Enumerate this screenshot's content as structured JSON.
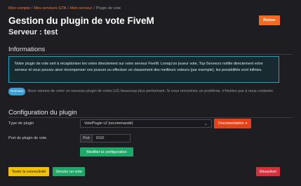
{
  "breadcrumb": {
    "items": [
      "Mon compte",
      "Mes serveurs GTA",
      "Mon serveur"
    ],
    "separator": "/",
    "current": "Plugin de vote"
  },
  "header": {
    "title": "Gestion du plugin de vote FiveM",
    "subtitle": "Serveur : test",
    "back_label": "Retour"
  },
  "info": {
    "title": "Informations",
    "text": "Notre plugin de vote sert à récapitoriser les votes directement sur votre serveur FiveM. Lorsqu'un joueur vote, Top-Serveurs notifie directement votre serveur et vous pouvez ainsi récompenser vos joueurs ou effectuer un classement des meilleurs voteurs (par exemple), les possibilités sont infinies."
  },
  "news": {
    "badge": "Nouveau",
    "text": "Nous venons de créer un nouveau plugin de votes (v2) beaucoup plus performant. Si vous rencontrez un problème, n'hésitez pas à nous contacter."
  },
  "config": {
    "title": "Configuration du plugin",
    "type_label": "Type de plugin",
    "type_value": "VotePlugin v2 (recommandé)",
    "doc_label": "Documentation",
    "port_label": "Port du plugin de vote",
    "port_prefix": "Port",
    "port_value": "8192",
    "save_label": "Modifier la configuration"
  },
  "actions": {
    "test_label": "Tester la connectivité",
    "simulate_label": "Simuler un vote",
    "disable_label": "Désactiver"
  },
  "colors": {
    "accent": "#f26b21",
    "info_border": "#1aa7bf",
    "success": "#1ea96a",
    "warning": "#f2c200",
    "danger": "#d72f3c"
  }
}
